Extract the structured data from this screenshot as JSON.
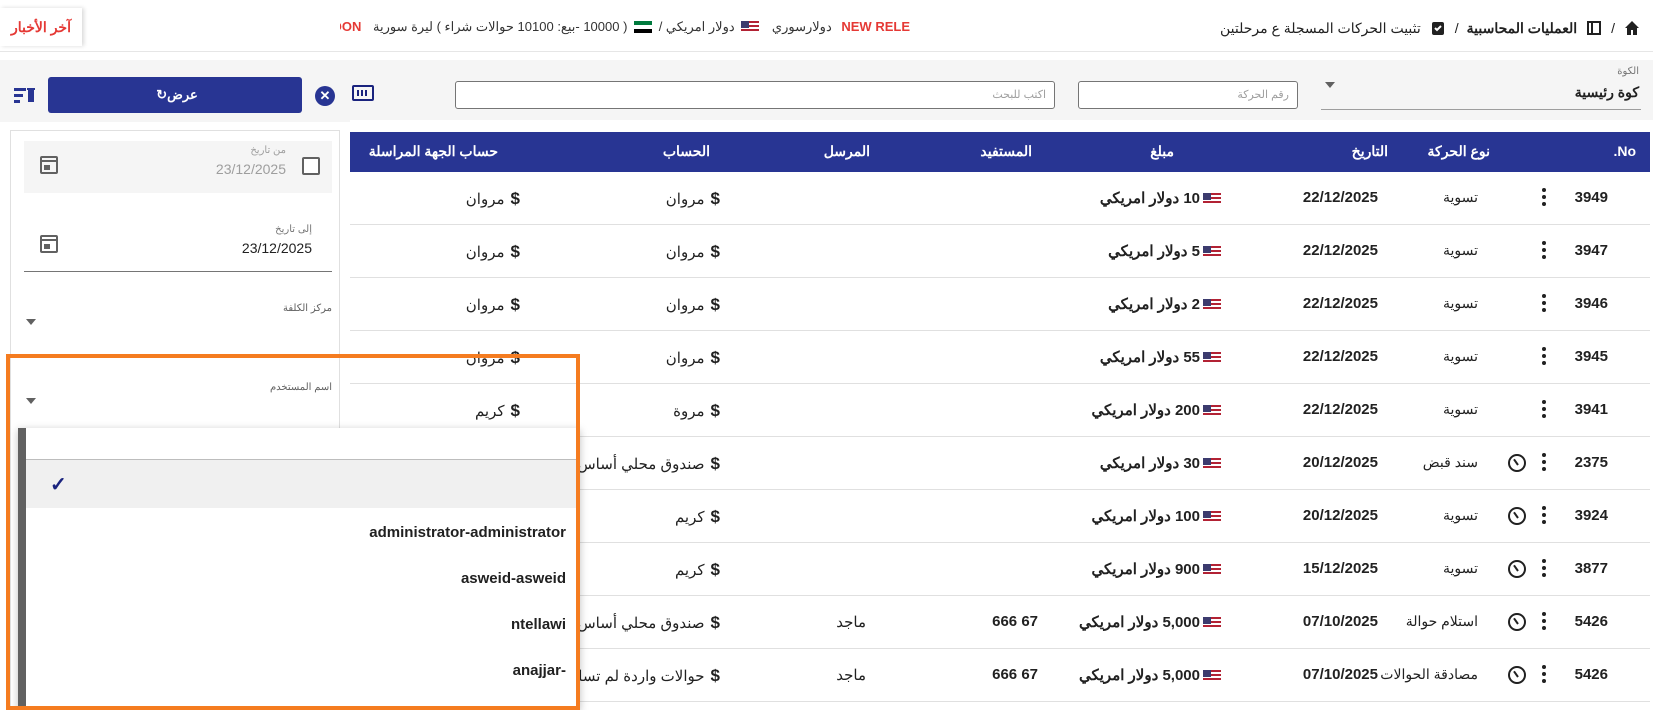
{
  "header": {
    "news_label": "آخر الأخبار",
    "ticker": {
      "soon": "SOON",
      "rate_text": "( 10000 -بيع: 10100 حوالات شراء ) ليرة سورية",
      "usd_text": "دولار امريكي /",
      "syp_text": "دولارسوري",
      "new_release": "NEW RELE"
    },
    "breadcrumb": {
      "section": "العمليات المحاسبية",
      "separator": "/",
      "page": "تثبيت الحركات المسجلة ع مرحلتين"
    }
  },
  "filters": {
    "koa_label": "الكوة",
    "koa_value": "كوة رئيسية",
    "txn_number_placeholder": "رقم الحركة",
    "search_placeholder": "اكتب للبحث"
  },
  "side_panel": {
    "show_button": "عرض",
    "from_date_label": "من تاريخ",
    "from_date_value": "23/12/2025",
    "to_date_label": "إلى تاريخ",
    "to_date_value": "23/12/2025",
    "cost_center_label": "مركز الكلفة",
    "username_label": "اسم المستخدم"
  },
  "table": {
    "headers": {
      "no": "No.",
      "type": "نوع الحركة",
      "date": "التاريخ",
      "amount": "مبلغ",
      "beneficiary": "المستفيد",
      "sender": "المرسل",
      "account": "الحساب",
      "corr_account": "حساب الجهة المراسلة"
    },
    "rows": [
      {
        "no": "3949",
        "type": "تسوية",
        "date": "22/12/2025",
        "amount": "10 دولار امريكي",
        "beneficiary": "",
        "sender": "",
        "account": "مروان",
        "corr": "مروان",
        "timer": false
      },
      {
        "no": "3947",
        "type": "تسوية",
        "date": "22/12/2025",
        "amount": "5 دولار امريكي",
        "beneficiary": "",
        "sender": "",
        "account": "مروان",
        "corr": "مروان",
        "timer": false
      },
      {
        "no": "3946",
        "type": "تسوية",
        "date": "22/12/2025",
        "amount": "2 دولار امريكي",
        "beneficiary": "",
        "sender": "",
        "account": "مروان",
        "corr": "مروان",
        "timer": false
      },
      {
        "no": "3945",
        "type": "تسوية",
        "date": "22/12/2025",
        "amount": "55 دولار امريكي",
        "beneficiary": "",
        "sender": "",
        "account": "مروان",
        "corr": "مروان",
        "timer": false
      },
      {
        "no": "3941",
        "type": "تسوية",
        "date": "22/12/2025",
        "amount": "200 دولار امريكي",
        "beneficiary": "",
        "sender": "",
        "account": "مروة",
        "corr": "كريم",
        "timer": false
      },
      {
        "no": "2375",
        "type": "سند قبض",
        "date": "20/12/2025",
        "amount": "30 دولار امريكي",
        "beneficiary": "",
        "sender": "",
        "account": "صندوق محلي أساس",
        "corr": "",
        "timer": true
      },
      {
        "no": "3924",
        "type": "تسوية",
        "date": "20/12/2025",
        "amount": "100 دولار امريكي",
        "beneficiary": "",
        "sender": "",
        "account": "كريم",
        "corr": "",
        "timer": true
      },
      {
        "no": "3877",
        "type": "تسوية",
        "date": "15/12/2025",
        "amount": "900 دولار امريكي",
        "beneficiary": "",
        "sender": "",
        "account": "كريم",
        "corr": "",
        "timer": true
      },
      {
        "no": "5426",
        "type": "استلام حوالة",
        "date": "07/10/2025",
        "amount": "5,000 دولار امريكي",
        "beneficiary": "67 666",
        "sender": "ماجد",
        "account": "صندوق محلي أساس",
        "corr": "",
        "timer": true
      },
      {
        "no": "5426",
        "type": "مصادقة الحوالات",
        "date": "07/10/2025",
        "amount": "5,000 دولار امريكي",
        "beneficiary": "67 666",
        "sender": "ماجد",
        "account": "حوالات واردة لم تسلم",
        "corr": "",
        "timer": true
      }
    ]
  },
  "dropdown": {
    "items": [
      {
        "label": "",
        "selected": true
      },
      {
        "label": "administrator-administrator",
        "selected": false
      },
      {
        "label": "asweid-asweid",
        "selected": false
      },
      {
        "label": "ntellawi",
        "selected": false
      },
      {
        "label": "-anajjar",
        "selected": false
      }
    ]
  },
  "colors": {
    "primary": "#283593",
    "news_red": "#e53935",
    "highlight": "#f57c20"
  }
}
